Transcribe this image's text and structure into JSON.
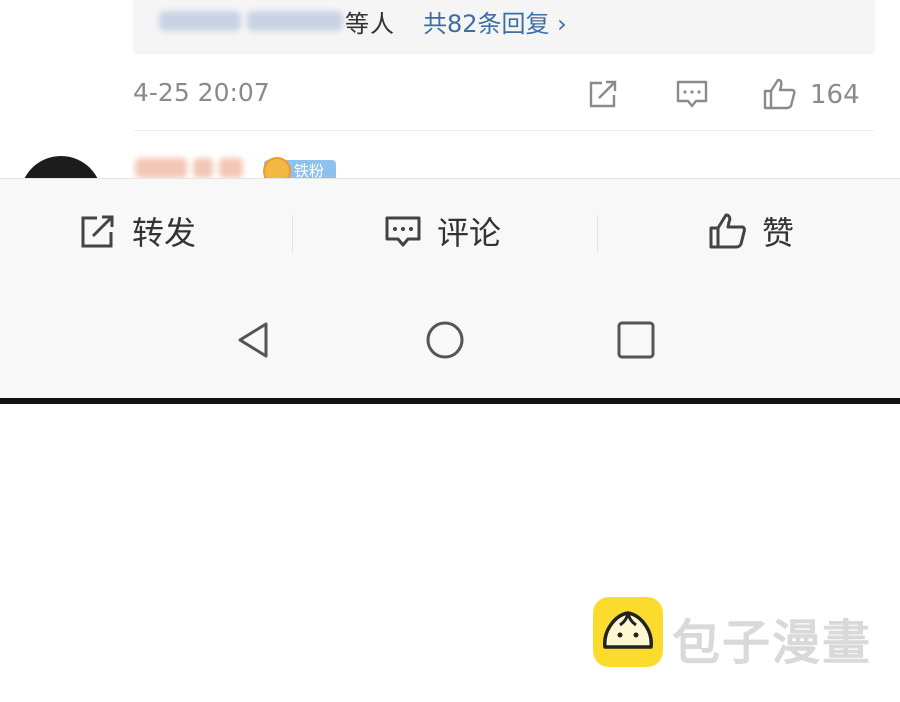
{
  "comment": {
    "reply_suffix": "等人",
    "reply_link": "共82条回复 ›",
    "time": "4-25 20:07",
    "like_count": "164",
    "icons": [
      "share-icon",
      "comment-icon",
      "like-icon"
    ]
  },
  "next_comment": {
    "badge": "铁粉"
  },
  "action_bar": {
    "repost": "转发",
    "comment": "评论",
    "like": "赞"
  },
  "nav_bar": {
    "icons": [
      "back-icon",
      "home-icon",
      "recents-icon"
    ]
  },
  "watermark": {
    "text": "包子漫畫"
  },
  "colors": {
    "link": "#3c6ea5",
    "meta_gray": "#8a8a8a",
    "bar_bg": "#f8f8f8",
    "badge_blue": "#8ec1ee",
    "logo_yellow": "#fadb2e"
  }
}
